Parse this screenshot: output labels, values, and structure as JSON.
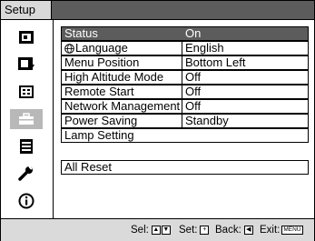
{
  "window": {
    "title": "Setup"
  },
  "sidebar": {
    "items": [
      {
        "icon": "picture-icon",
        "selected": false
      },
      {
        "icon": "picture-adjust-icon",
        "selected": false
      },
      {
        "icon": "screen-icon",
        "selected": false
      },
      {
        "icon": "setup-toolbox-icon",
        "selected": true
      },
      {
        "icon": "menu-list-icon",
        "selected": false
      },
      {
        "icon": "wrench-icon",
        "selected": false
      },
      {
        "icon": "info-icon",
        "selected": false
      }
    ]
  },
  "menu": {
    "rows": [
      {
        "label": "Status",
        "value": "On",
        "selected": true
      },
      {
        "label": "Language",
        "value": "English",
        "has_icon": "globe-icon"
      },
      {
        "label": "Menu Position",
        "value": "Bottom Left"
      },
      {
        "label": "High Altitude Mode",
        "value": "Off"
      },
      {
        "label": "Remote Start",
        "value": "Off"
      },
      {
        "label": "Network Management",
        "value": "Off"
      },
      {
        "label": "Power Saving",
        "value": "Standby"
      },
      {
        "label": "Lamp Setting",
        "value": ""
      },
      {
        "label": "All Reset",
        "value": ""
      }
    ]
  },
  "statusbar": {
    "sel_label": "Sel:",
    "set_label": "Set:",
    "back_label": "Back:",
    "exit_label": "Exit:",
    "exit_key": "MENU"
  },
  "colors": {
    "selected_row": "#5c5c5c",
    "titlebar": "#5c5c5c",
    "statusbar": "#dadada",
    "sidebar_selected": "#b8b8b8"
  }
}
